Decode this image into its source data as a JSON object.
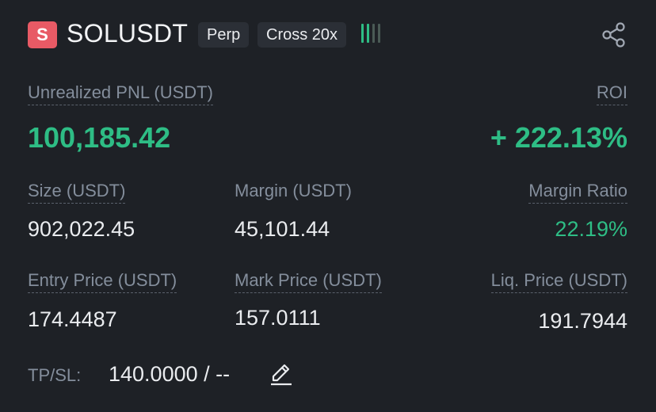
{
  "header": {
    "symbol_badge": "S",
    "symbol": "SOLUSDT",
    "type_tag": "Perp",
    "margin_tag": "Cross 20x",
    "signal_icon": "adl-bars-icon",
    "share_icon": "share-icon"
  },
  "pnl": {
    "label": "Unrealized PNL (USDT)",
    "value": "100,185.42"
  },
  "roi": {
    "label": "ROI",
    "value": "+ 222.13%"
  },
  "size": {
    "label": "Size (USDT)",
    "value": "902,022.45"
  },
  "margin": {
    "label": "Margin (USDT)",
    "value": "45,101.44"
  },
  "margin_ratio": {
    "label": "Margin Ratio",
    "value": "22.19%"
  },
  "entry_price": {
    "label": "Entry Price (USDT)",
    "value": "174.4487"
  },
  "mark_price": {
    "label": "Mark Price (USDT)",
    "value": "157.0111"
  },
  "liq_price": {
    "label": "Liq. Price (USDT)",
    "value": "191.7944"
  },
  "tpsl": {
    "label": "TP/SL:",
    "value": "140.0000 / --",
    "edit_icon": "pencil-icon"
  },
  "colors": {
    "background": "#1e2126",
    "positive": "#2ebd85",
    "badge": "#e85a65",
    "muted": "#848e9c"
  }
}
